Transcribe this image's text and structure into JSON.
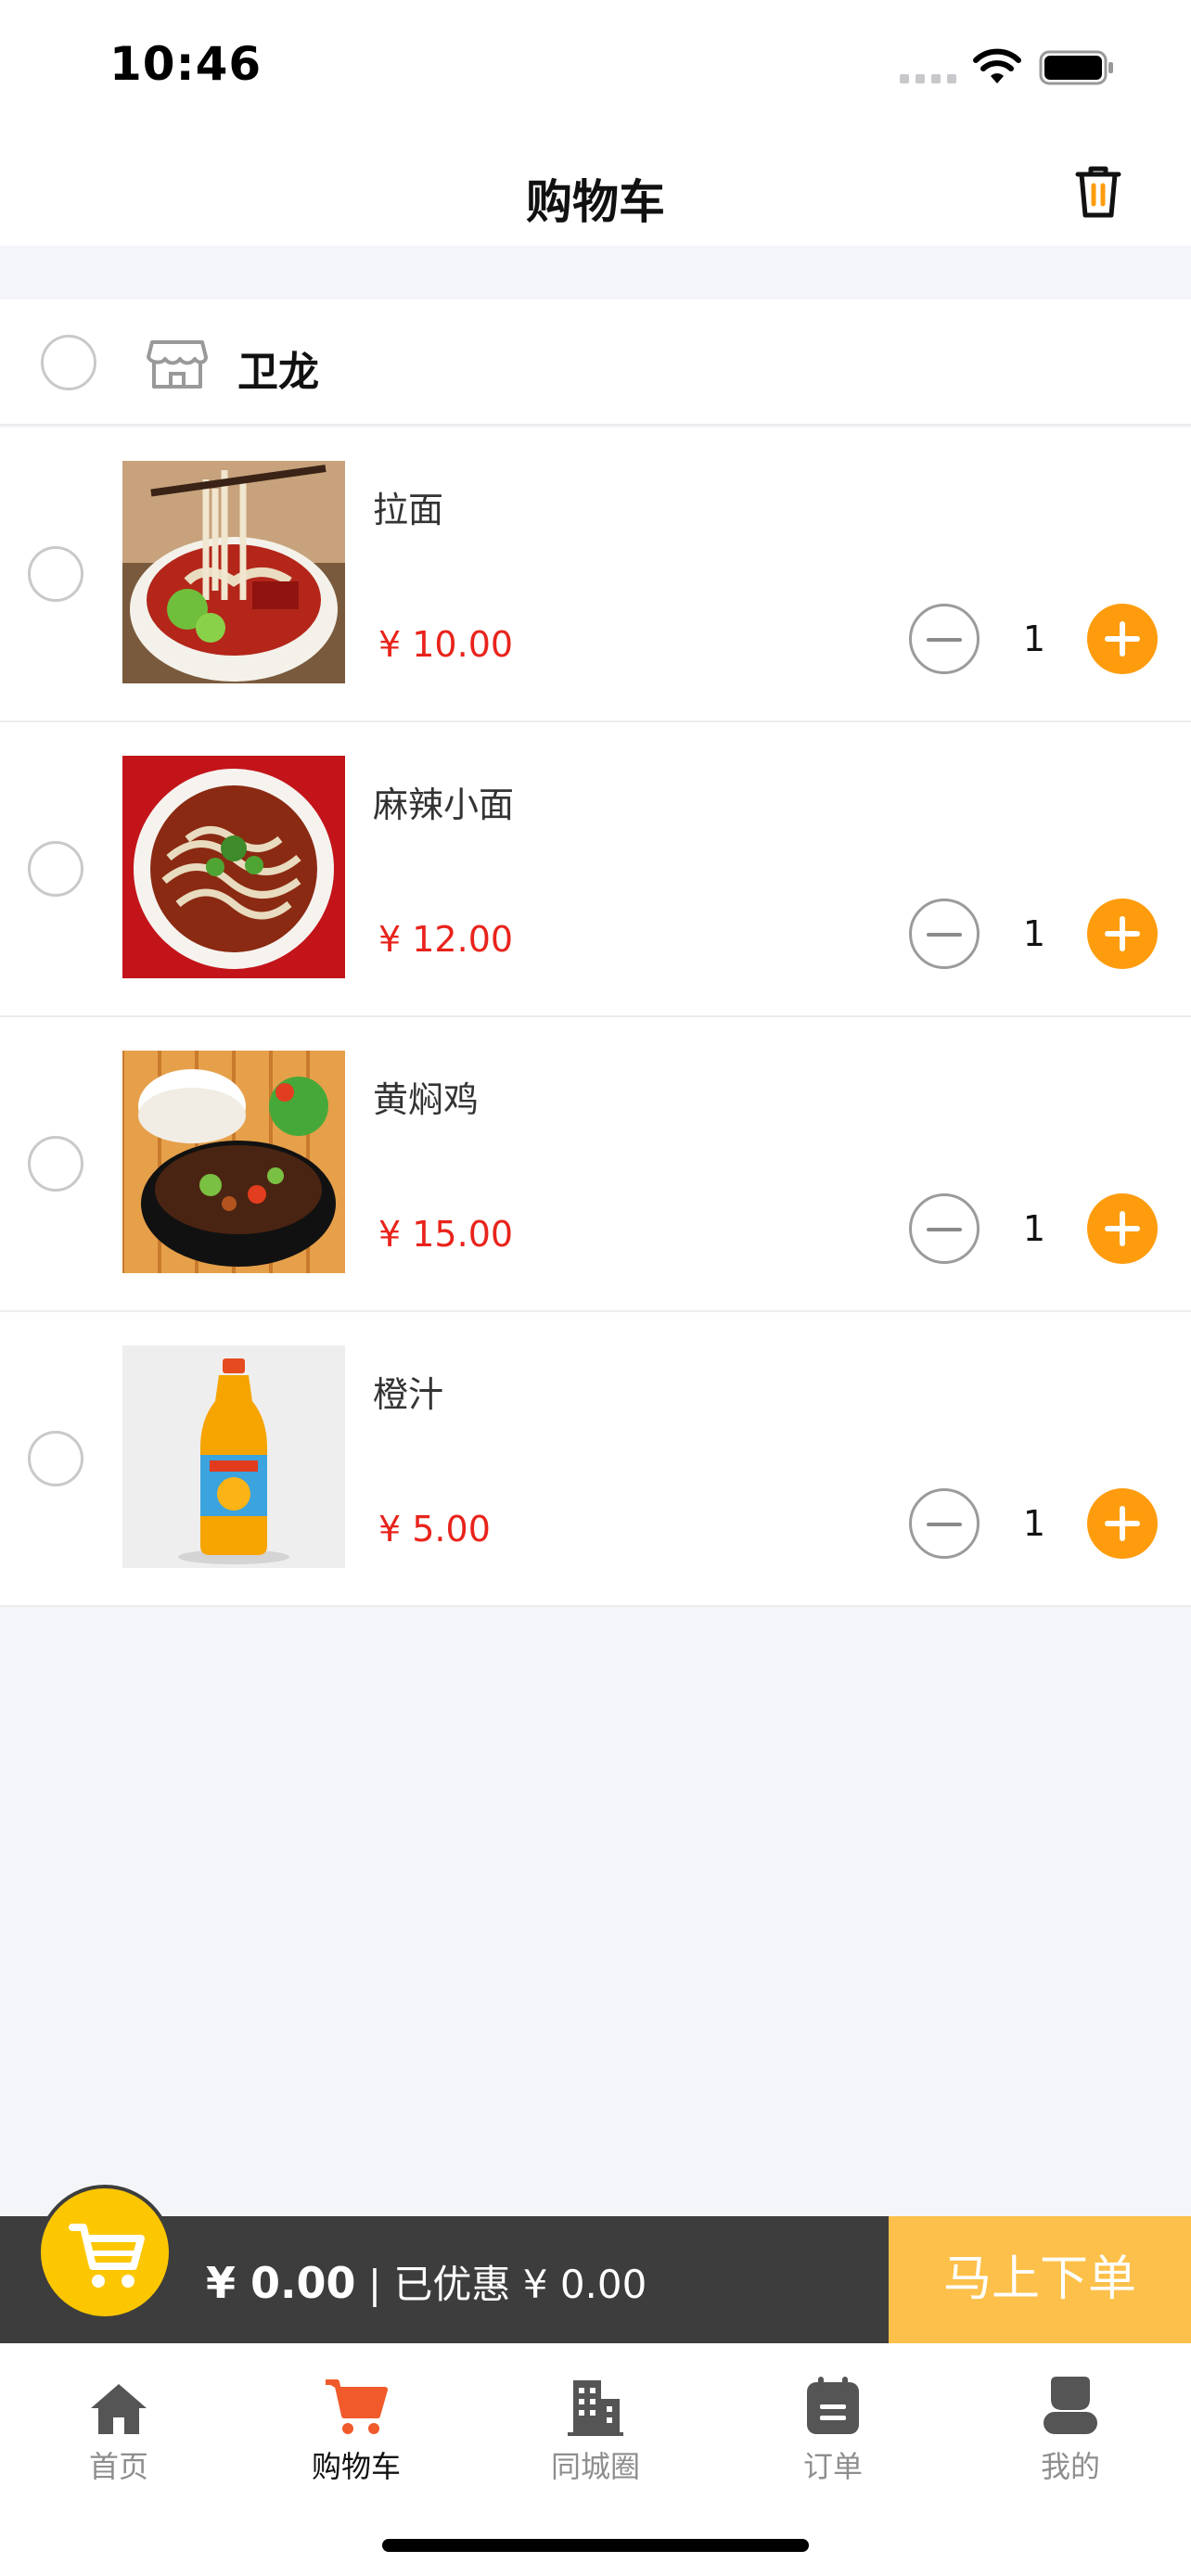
{
  "status_bar": {
    "time": "10:46"
  },
  "header": {
    "title": "购物车"
  },
  "store": {
    "name": "卫龙"
  },
  "items": [
    {
      "name": "拉面",
      "price": "¥ 10.00",
      "qty": "1"
    },
    {
      "name": "麻辣小面",
      "price": "¥ 12.00",
      "qty": "1"
    },
    {
      "name": "黄焖鸡",
      "price": "¥ 15.00",
      "qty": "1"
    },
    {
      "name": "橙汁",
      "price": "¥ 5.00",
      "qty": "1"
    }
  ],
  "checkout": {
    "total": "¥ 0.00",
    "separator": " | ",
    "discount": "已优惠 ¥ 0.00",
    "order_button": "马上下单"
  },
  "tabs": [
    {
      "label": "首页",
      "icon": "home-icon"
    },
    {
      "label": "购物车",
      "icon": "cart-icon"
    },
    {
      "label": "同城圈",
      "icon": "city-building-icon"
    },
    {
      "label": "订单",
      "icon": "order-icon"
    },
    {
      "label": "我的",
      "icon": "profile-icon"
    }
  ],
  "colors": {
    "accent_orange": "#fe9c0e",
    "price_red": "#e8231b",
    "checkout_dark": "#3d3d3d",
    "order_button": "#fdc04a",
    "cart_bubble": "#fcc700",
    "active_tab_icon": "#f15a2b"
  }
}
